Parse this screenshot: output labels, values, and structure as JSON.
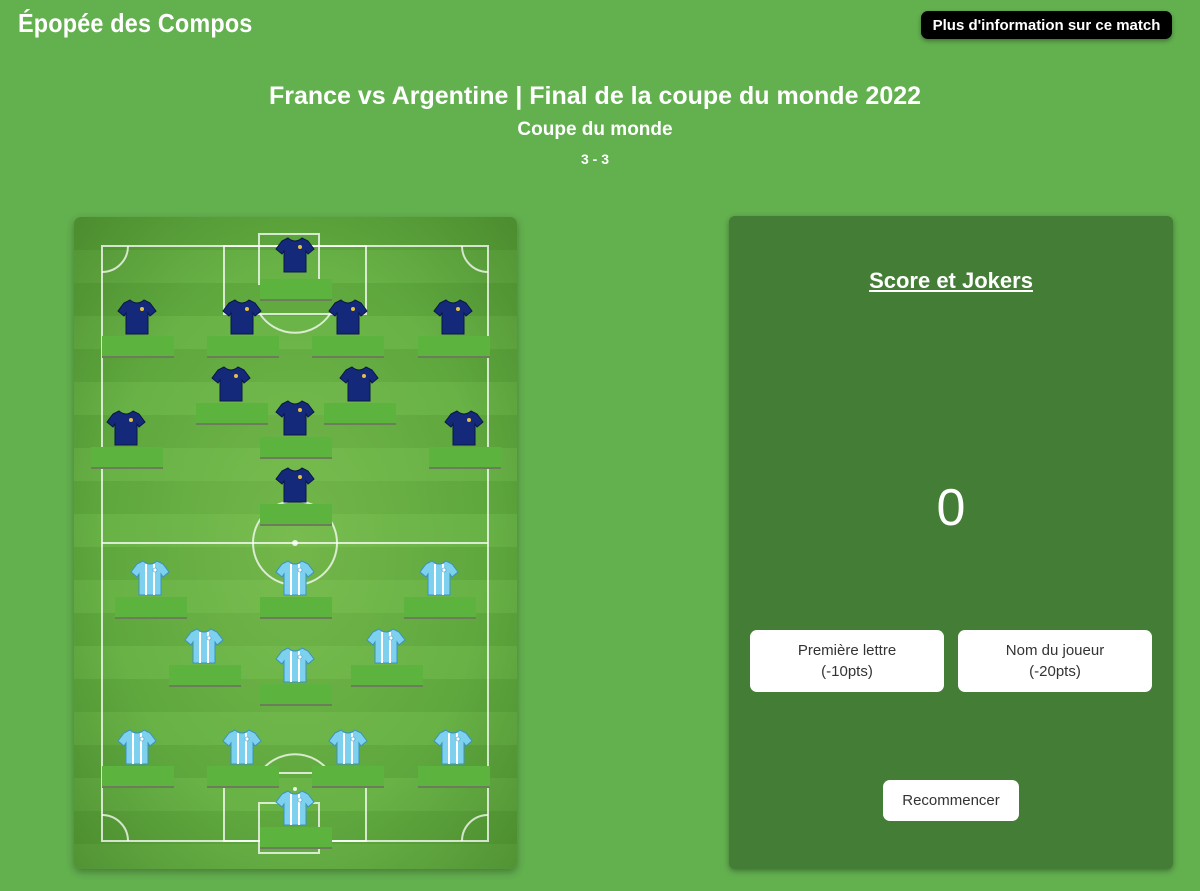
{
  "app": {
    "title": "Épopée des Compos"
  },
  "header": {
    "info_button": "Plus d'information sur ce match"
  },
  "match": {
    "title": "France vs Argentine | Final de la coupe du monde 2022",
    "competition": "Coupe du monde",
    "score": "3 - 3"
  },
  "teams": {
    "top": {
      "jersey_color": "#14297a",
      "icon": "france-jersey-icon",
      "players": 11
    },
    "bottom": {
      "jersey_color": "#7dd0ee",
      "icon": "argentina-jersey-icon",
      "players": 11
    }
  },
  "panel": {
    "title": "Score et Jokers",
    "points": "0",
    "joker_first_letter": {
      "label": "Première lettre",
      "cost": "(-10pts)"
    },
    "joker_player_name": {
      "label": "Nom du joueur",
      "cost": "(-20pts)"
    },
    "restart_button": "Recommencer"
  },
  "colors": {
    "background": "#63b04f",
    "panel": "#447d35",
    "france": "#14297a",
    "argentina": "#7dd0ee"
  }
}
